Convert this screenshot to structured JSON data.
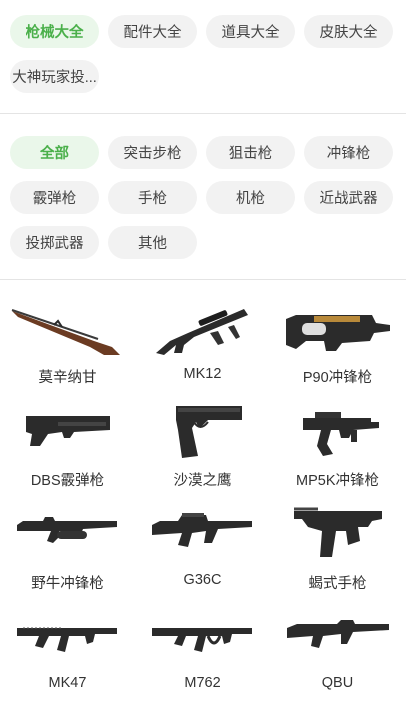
{
  "top_tabs": [
    {
      "label": "枪械大全",
      "active": true
    },
    {
      "label": "配件大全",
      "active": false
    },
    {
      "label": "道具大全",
      "active": false
    },
    {
      "label": "皮肤大全",
      "active": false
    },
    {
      "label": "大神玩家投...",
      "active": false
    }
  ],
  "filters": [
    {
      "label": "全部",
      "active": true
    },
    {
      "label": "突击步枪",
      "active": false
    },
    {
      "label": "狙击枪",
      "active": false
    },
    {
      "label": "冲锋枪",
      "active": false
    },
    {
      "label": "霰弹枪",
      "active": false
    },
    {
      "label": "手枪",
      "active": false
    },
    {
      "label": "机枪",
      "active": false
    },
    {
      "label": "近战武器",
      "active": false
    },
    {
      "label": "投掷武器",
      "active": false
    },
    {
      "label": "其他",
      "active": false
    }
  ],
  "weapons": [
    {
      "name": "莫辛纳甘",
      "icon": "mosin-rifle-icon"
    },
    {
      "name": "MK12",
      "icon": "mk12-rifle-icon"
    },
    {
      "name": "P90冲锋枪",
      "icon": "p90-smg-icon"
    },
    {
      "name": "DBS霰弹枪",
      "icon": "dbs-shotgun-icon"
    },
    {
      "name": "沙漠之鹰",
      "icon": "desert-eagle-icon"
    },
    {
      "name": "MP5K冲锋枪",
      "icon": "mp5k-smg-icon"
    },
    {
      "name": "野牛冲锋枪",
      "icon": "bizon-smg-icon"
    },
    {
      "name": "G36C",
      "icon": "g36c-rifle-icon"
    },
    {
      "name": "蝎式手枪",
      "icon": "skorpion-pistol-icon"
    },
    {
      "name": "MK47",
      "icon": "mk47-rifle-icon"
    },
    {
      "name": "M762",
      "icon": "m762-rifle-icon"
    },
    {
      "name": "QBU",
      "icon": "qbu-rifle-icon"
    }
  ],
  "colors": {
    "accent": "#4ab04a",
    "active_bg": "#eaf7ea",
    "chip_bg": "#f2f2f2",
    "gun_dark": "#2b2b2b",
    "wood": "#6b3b22"
  }
}
